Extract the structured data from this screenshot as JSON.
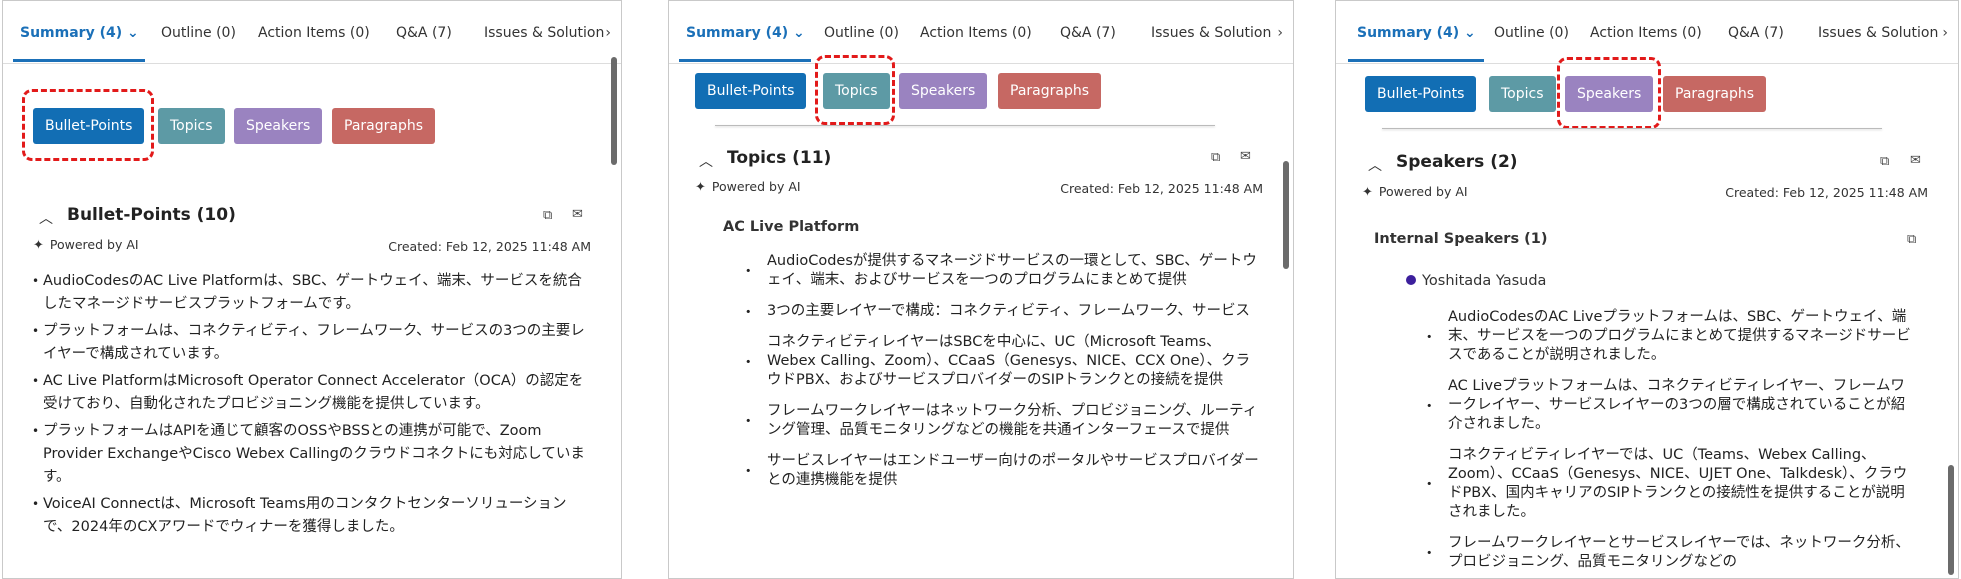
{
  "tabs": {
    "summary": "Summary (4)",
    "outline": "Outline (0)",
    "action_items": "Action Items (0)",
    "qa": "Q&A (7)",
    "issues": "Issues & Solution",
    "more": "›",
    "dropdown": "⌄"
  },
  "buttons": {
    "bullet_points": "Bullet-Points",
    "topics": "Topics",
    "speakers": "Speakers",
    "paragraphs": "Paragraphs"
  },
  "powered_by": "Powered by AI",
  "created": "Created: Feb 12, 2025 11:48 AM",
  "panel1": {
    "title": "Bullet-Points (10)",
    "items": [
      "AudioCodesのAC Live Platformは、SBC、ゲートウェイ、端末、サービスを統合したマネージドサービスプラットフォームです。",
      "プラットフォームは、コネクティビティ、フレームワーク、サービスの3つの主要レイヤーで構成されています。",
      "AC Live PlatformはMicrosoft Operator Connect Accelerator（OCA）の認定を受けており、自動化されたプロビジョニング機能を提供しています。",
      "プラットフォームはAPIを通じて顧客のOSSやBSSとの連携が可能で、Zoom Provider ExchangeやCisco Webex Callingのクラウドコネクトにも対応しています。",
      "VoiceAI Connectは、Microsoft Teams用のコンタクトセンターソリューションで、2024年のCXアワードでウィナーを獲得しました。"
    ]
  },
  "panel2": {
    "title": "Topics (11)",
    "subtitle": "AC Live Platform",
    "items": [
      "AudioCodesが提供するマネージドサービスの一環として、SBC、ゲートウェイ、端末、およびサービスを一つのプログラムにまとめて提供",
      "3つの主要レイヤーで構成：コネクティビティ、フレームワーク、サービス",
      "コネクティビティレイヤーはSBCを中心に、UC（Microsoft Teams、Webex Calling、Zoom）、CCaaS（Genesys、NICE、CCX One）、クラウドPBX、およびサービスプロバイダーのSIPトランクとの接続を提供",
      "フレームワークレイヤーはネットワーク分析、プロビジョニング、ルーティング管理、品質モニタリングなどの機能を共通インターフェースで提供",
      "サービスレイヤーはエンドユーザー向けのポータルやサービスプロバイダーとの連携機能を提供"
    ]
  },
  "panel3": {
    "title": "Speakers (2)",
    "subtitle": "Internal Speakers (1)",
    "speaker": "Yoshitada Yasuda",
    "items": [
      "AudioCodesのAC Liveプラットフォームは、SBC、ゲートウェイ、端末、サービスを一つのプログラムにまとめて提供するマネージドサービスであることが説明されました。",
      "AC Liveプラットフォームは、コネクティビティレイヤー、フレームワークレイヤー、サービスレイヤーの3つの層で構成されていることが紹介されました。",
      "コネクティビティレイヤーでは、UC（Teams、Webex Calling、Zoom）、CCaaS（Genesys、NICE、UJET One、Talkdesk）、クラウドPBX、国内キャリアのSIPトランクとの接続性を提供することが説明されました。",
      "フレームワークレイヤーとサービスレイヤーでは、ネットワーク分析、プロビジョニング、品質モニタリングなどの"
    ]
  },
  "icons": {
    "copy": "copy-icon",
    "email": "email-icon",
    "sparkle": "sparkle-icon",
    "collapse": "chevron-up-icon"
  },
  "colors": {
    "active_tab": "#1b70b8",
    "bullet_points": "#126eb4",
    "topics": "#5d9aa5",
    "speakers": "#9a83c0",
    "paragraphs": "#c66863",
    "highlight": "#e21a1a"
  }
}
